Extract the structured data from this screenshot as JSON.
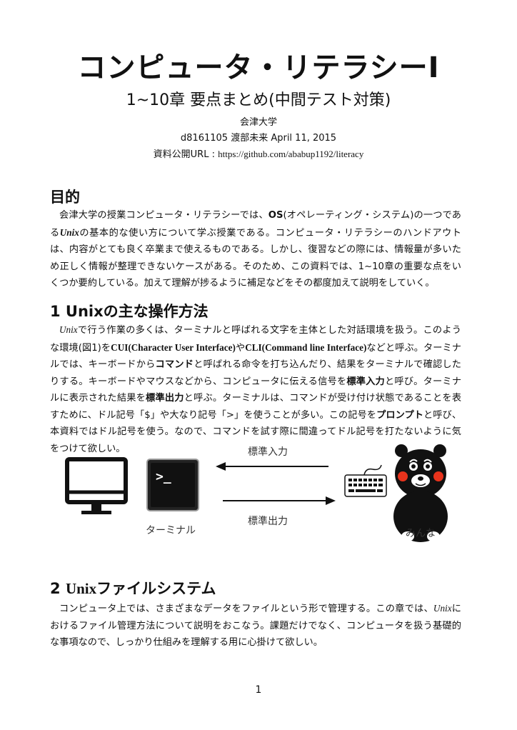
{
  "header": {
    "title": "コンピュータ・リテラシーI",
    "subtitle": "1~10章 要点まとめ(中間テスト対策)",
    "university": "会津大学",
    "author_line": "d8161105 渡部未来 April 11, 2015",
    "url_label": "資料公開URL : ",
    "url": "https://github.com/ababup1192/literacy"
  },
  "purpose": {
    "heading": "目的",
    "p_1": "会津大学の授業コンピュータ・リテラシーでは、",
    "p_os": "OS",
    "p_2": "(オペレーティング・システム)の一つである",
    "p_unix": "Unix",
    "p_3": "の基本的な使い方について学ぶ授業である。コンピュータ・リテラシーのハンドアウトは、内容がとても良く卒業まで使えるものである。しかし、復習などの際には、情報量が多いため正しく情報が整理できないケースがある。そのため、この資料では、1~10章の重要な点をいくつか要約している。加えて理解が捗るように補足などをその都度加えて説明をしていく。"
  },
  "section1": {
    "heading": "1 Unixの主な操作方法",
    "p_unix": "Unix",
    "p_1": "で行う作業の多くは、ターミナルと呼ばれる文字を主体とした対話環境を扱う。このような環境(図1)を",
    "p_cui": "CUI(Character User Interface)",
    "p_2": "や",
    "p_cli": "CLI(Command line Interface)",
    "p_3": "などと呼ぶ。ターミナルでは、キーボードから",
    "p_command": "コマンド",
    "p_4": "と呼ばれる命令を打ち込んだり、結果をターミナルで確認したりする。キーボードやマウスなどから、コンピュータに伝える信号を",
    "p_stdin": "標準入力",
    "p_5": "と呼び。ターミナルに表示された結果を",
    "p_stdout": "標準出力",
    "p_6": "と呼ぶ。ターミナルは、コマンドが受け付け状態であることを表すために、ドル記号「$」や大なり記号「>」を使うことが多い。この記号を",
    "p_prompt": "プロンプト",
    "p_7": "と呼び、本資料ではドル記号を使う。なので、コマンドを試す際に間違ってドル記号を打たないように気をつけて欲しい。"
  },
  "figure": {
    "label_input": "標準入力",
    "label_output": "標準出力",
    "label_terminal": "ターミナル",
    "label_everyone": "みんな",
    "terminal_prompt": ">_"
  },
  "section2": {
    "heading_num": "2 ",
    "heading_unix": "Unix",
    "heading_rest": "ファイルシステム",
    "p_1": "コンピュータ上では、さまざまなデータをファイルという形で管理する。この章では、",
    "p_unix": "Unix",
    "p_2": "におけるファイル管理方法について説明をおこなう。課題だけでなく、コンピュータを扱う基礎的な事項なので、しっかり仕組みを理解する用に心掛けて欲しい。"
  },
  "footer": {
    "page_number": "1"
  }
}
